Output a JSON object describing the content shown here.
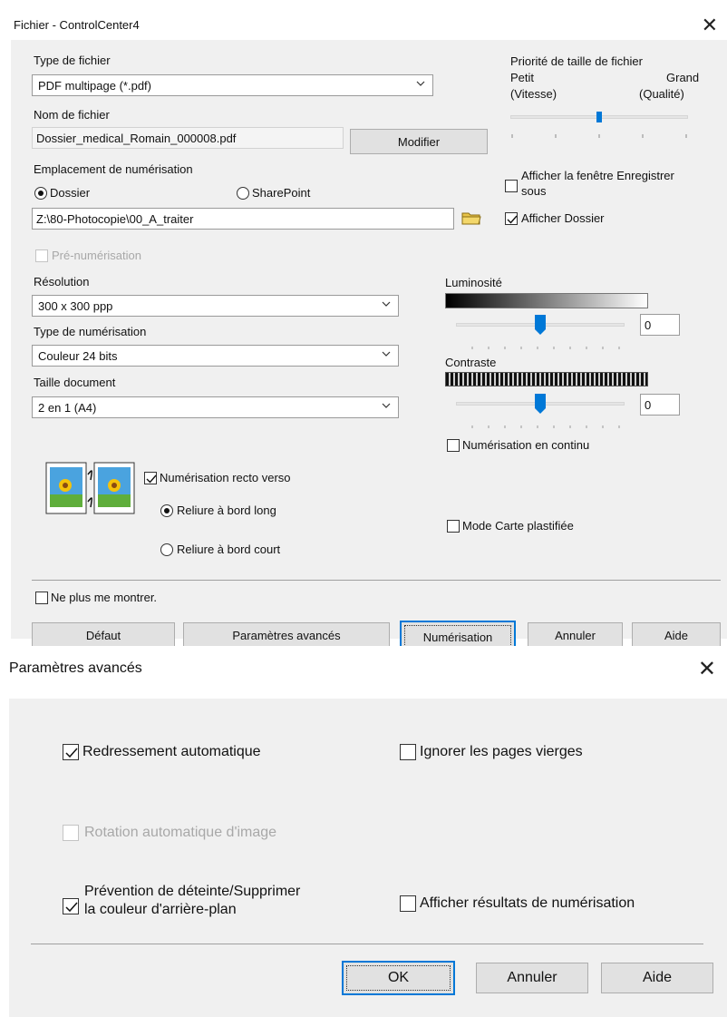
{
  "dialog1": {
    "title": "Fichier - ControlCenter4",
    "file_type_label": "Type de fichier",
    "file_type_value": "PDF multipage (*.pdf)",
    "file_name_label": "Nom de fichier",
    "file_name_value": "Dossier_medical_Romain_000008.pdf",
    "modify_button": "Modifier",
    "priority": {
      "label": "Priorité de taille de fichier",
      "small_label": "Petit",
      "small_sub": "(Vitesse)",
      "large_label": "Grand",
      "large_sub": "(Qualité)",
      "level": 0.5
    },
    "location_label": "Emplacement de numérisation",
    "radio_folder": "Dossier",
    "radio_sharepoint": "SharePoint",
    "folder_path": "Z:\\80-Photocopie\\00_A_traiter",
    "show_save_as_line1": "Afficher la fenêtre Enregistrer",
    "show_save_as_line2": "sous",
    "show_folder": "Afficher Dossier",
    "prescan": "Pré-numérisation",
    "resolution_label": "Résolution",
    "resolution_value": "300 x 300 ppp",
    "scan_type_label": "Type de numérisation",
    "scan_type_value": "Couleur 24 bits",
    "doc_size_label": "Taille document",
    "doc_size_value": "2 en 1 (A4)",
    "brightness_label": "Luminosité",
    "brightness_value": "0",
    "brightness_level": 0.5,
    "contrast_label": "Contraste",
    "contrast_value": "0",
    "contrast_level": 0.5,
    "continuous_scan": "Numérisation en continu",
    "duplex_scan": "Numérisation recto verso",
    "long_edge": "Reliure à bord long",
    "short_edge": "Reliure à bord court",
    "plastic_card": "Mode Carte plastifiée",
    "dont_show": "Ne plus me montrer.",
    "buttons": {
      "default": "Défaut",
      "advanced": "Paramètres avancés",
      "scan": "Numérisation",
      "cancel": "Annuler",
      "help": "Aide"
    }
  },
  "dialog2": {
    "title": "Paramètres avancés",
    "auto_deskew": "Redressement automatique",
    "skip_blank": "Ignorer les pages vierges",
    "auto_rotate": "Rotation automatique d'image",
    "bleed_line1": "Prévention de déteinte/Supprimer",
    "bleed_line2": "la couleur d'arrière-plan",
    "show_results": "Afficher résultats de numérisation",
    "buttons": {
      "ok": "OK",
      "cancel": "Annuler",
      "help": "Aide"
    }
  },
  "colors": {
    "accent": "#0078d7",
    "dialog_bg": "#f0f0f0",
    "slider_thumb": "#0078d7"
  }
}
